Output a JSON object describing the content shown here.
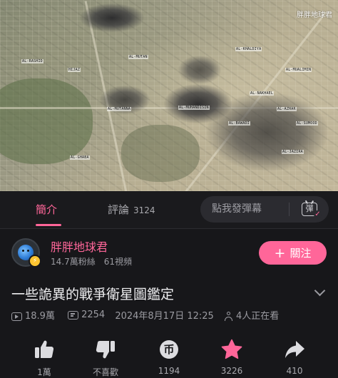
{
  "video": {
    "watermark": "胖胖地球君",
    "map_labels": [
      "AL-MUTAN",
      "AL-MUTANNA",
      "HIJAZ",
      "AL-KHALDIYA",
      "AL-AZHAR",
      "AL-BAWADI",
      "AL-GHABA",
      "AL-JAZIRA",
      "AL-NAKHAEL",
      "AL-MUHANDISIN",
      "AL-MUALIMIN",
      "AL-RASHID",
      "AL-SUMOOD"
    ]
  },
  "tabs": {
    "intro_label": "簡介",
    "comments_label": "評論",
    "comments_count": "3124",
    "danmaku_placeholder": "點我發彈幕",
    "danmaku_toggle_glyph": "彈"
  },
  "uploader": {
    "name": "胖胖地球君",
    "followers": "14.7萬粉絲",
    "videos": "61視頻",
    "follow_plus": "+",
    "follow_label": "關注"
  },
  "video_info": {
    "title": "一些詭異的戰爭衛星圖鑑定",
    "views": "18.9萬",
    "danmaku_count": "2254",
    "datetime": "2024年8月17日 12:25",
    "watching": "4人正在看"
  },
  "actions": {
    "like": "1萬",
    "dislike": "不喜歡",
    "coin": "1194",
    "coin_glyph": "币",
    "favorite": "3226",
    "share": "410"
  },
  "colors": {
    "accent": "#ff6699",
    "background": "#17171a",
    "muted_text": "#9b9ba1"
  }
}
